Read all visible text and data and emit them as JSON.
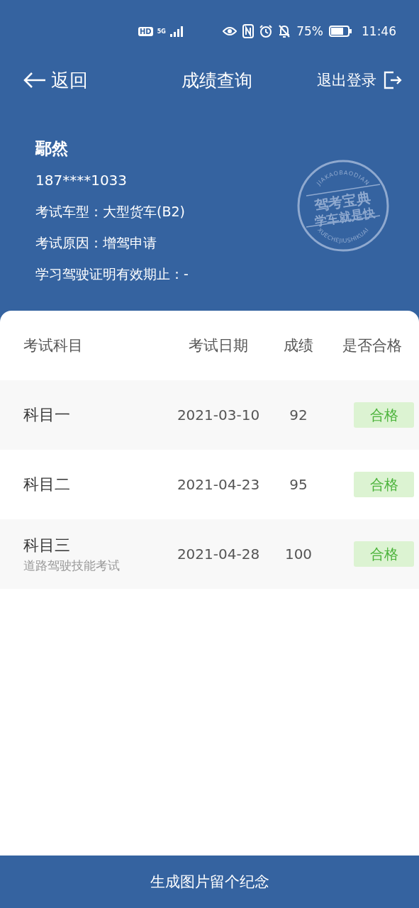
{
  "status_bar": {
    "hd": "HD",
    "network": "5G",
    "battery_text": "75%",
    "time": "11:46"
  },
  "nav": {
    "back": "返回",
    "title": "成绩查询",
    "logout": "退出登录"
  },
  "profile": {
    "name": "鄢然",
    "phone": "187****1033",
    "lines": [
      "考试车型：大型货车(B2)",
      "考试原因：增驾申请",
      "学习驾驶证明有效期止：-"
    ]
  },
  "seal": {
    "top": "JIAKAOBAODIAN",
    "line_1": "驾考宝典",
    "line_2": "学车就是快",
    "bottom": "XUECHEJIUSHIKUAI"
  },
  "table": {
    "columns": [
      "考试科目",
      "考试日期",
      "成绩",
      "是否合格"
    ],
    "rows": [
      {
        "subject": "科目一",
        "date": "2021-03-10",
        "score": "92",
        "result": "合格",
        "passed": true
      },
      {
        "subject": "科目二",
        "date": "2021-04-23",
        "score": "95",
        "result": "合格",
        "passed": true
      },
      {
        "subject": "科目三",
        "note": "道路驾驶技能考试",
        "date": "2021-04-28",
        "score": "100",
        "result": "合格",
        "passed": true
      }
    ]
  },
  "bottom_button": "生成图片留个纪念"
}
